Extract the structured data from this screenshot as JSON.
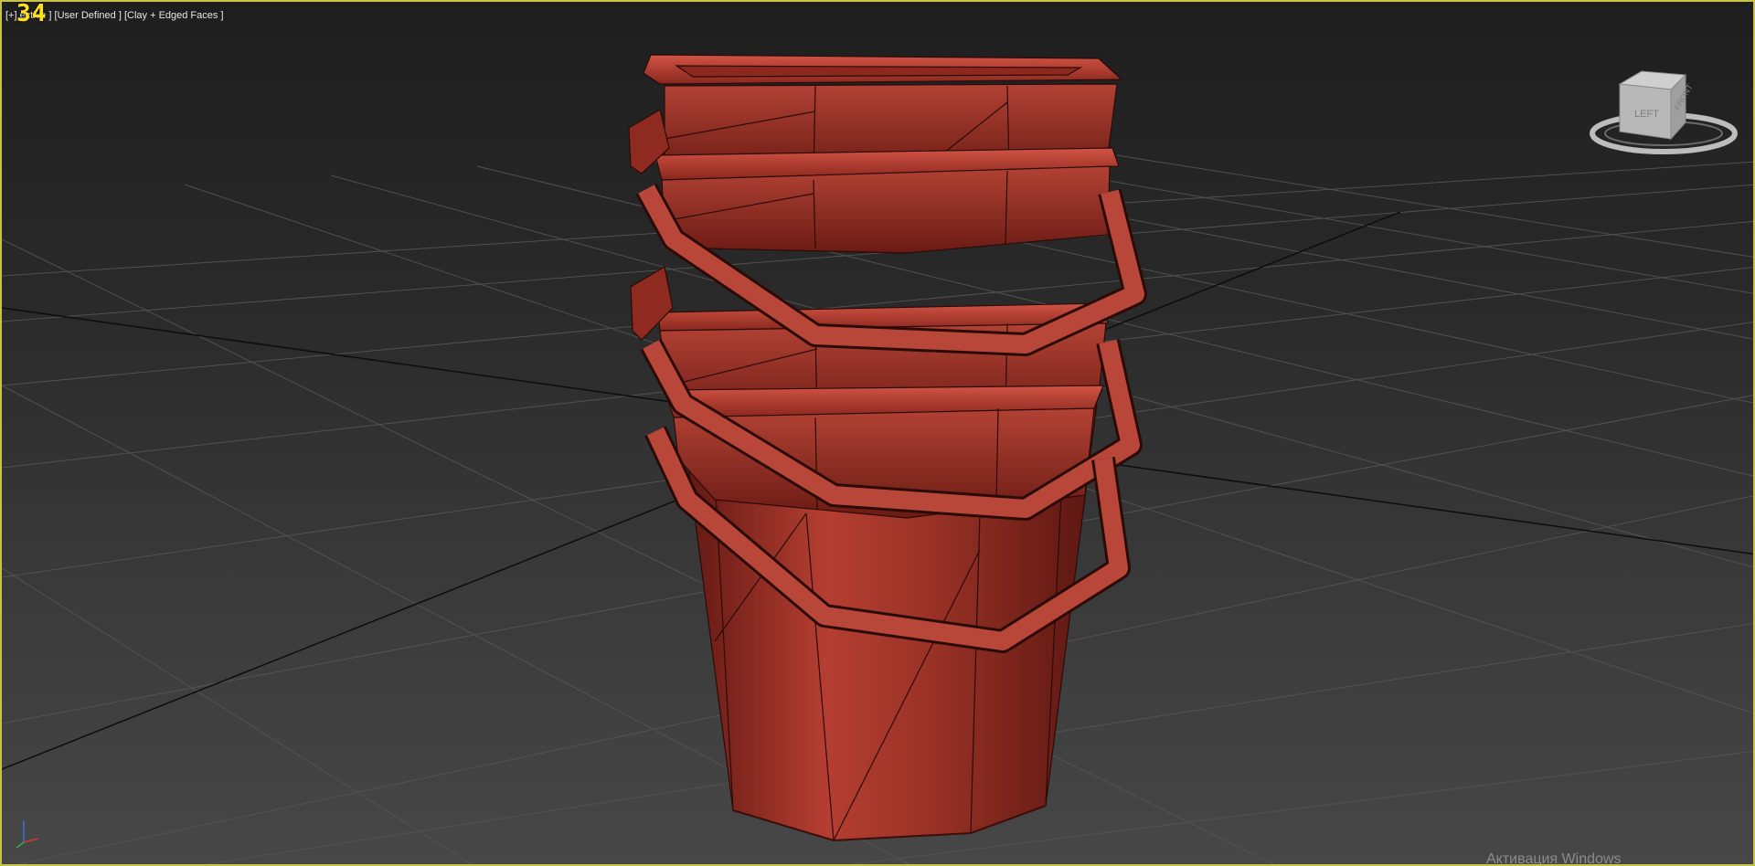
{
  "viewport": {
    "label_plus": "[+]",
    "label_view": "[Perspective]",
    "label_view_visible": "ective ]",
    "label_camera": "[User Defined ]",
    "label_shading": "[Clay + Edged Faces ]",
    "fps_counter": "34",
    "border_color": "#c9c24a"
  },
  "viewcube": {
    "face_left": "LEFT",
    "face_front": "FRONT"
  },
  "axis_tripod": {
    "x": "x",
    "y": "y",
    "z": "z"
  },
  "watermark": {
    "text": "Активация Windows"
  },
  "scene": {
    "object": "stacked buckets",
    "object_color": "#a8372c",
    "grid_color": "#5a5a5a",
    "edge_color": "#1a0a08"
  }
}
